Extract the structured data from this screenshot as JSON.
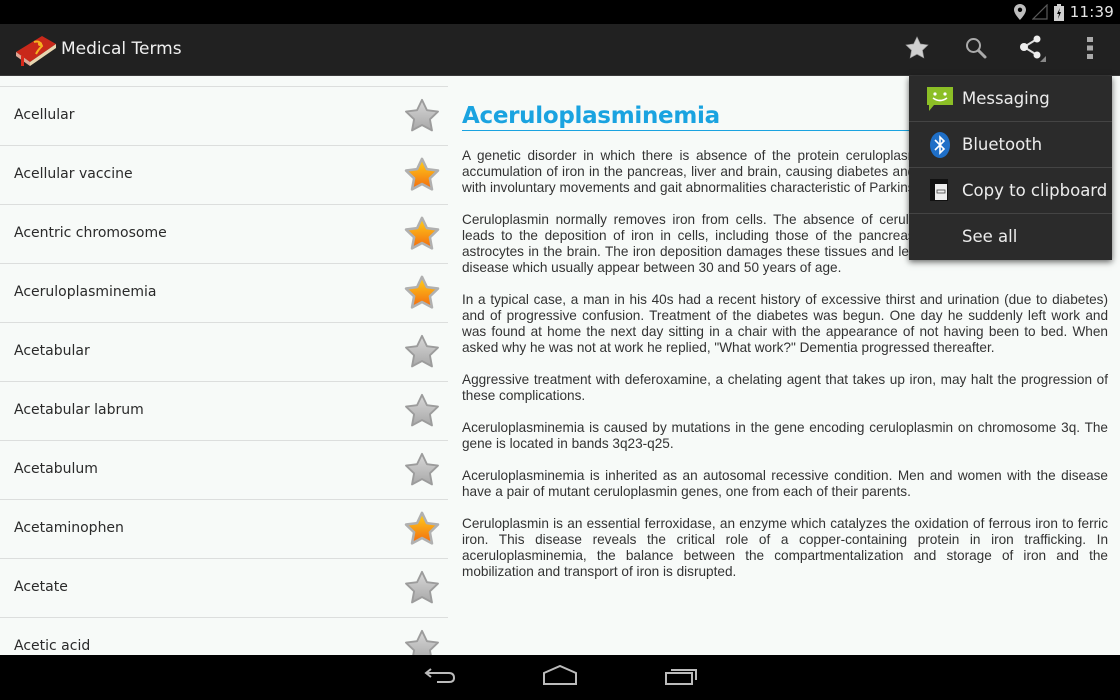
{
  "status_bar": {
    "time": "11:39",
    "icons": [
      "location-icon",
      "signal-icon",
      "battery-charging-icon"
    ]
  },
  "action_bar": {
    "title": "Medical Terms",
    "logo_icon": "medical-book-icon",
    "actions": [
      {
        "name": "favorites",
        "icon": "star-icon"
      },
      {
        "name": "search",
        "icon": "search-icon"
      },
      {
        "name": "share",
        "icon": "share-icon"
      },
      {
        "name": "overflow",
        "icon": "overflow-menu-icon"
      }
    ]
  },
  "term_list": {
    "items": [
      {
        "label": "Acellular",
        "favorite": false
      },
      {
        "label": "Acellular vaccine",
        "favorite": true
      },
      {
        "label": "Acentric chromosome",
        "favorite": true
      },
      {
        "label": "Aceruloplasminemia",
        "favorite": true
      },
      {
        "label": "Acetabular",
        "favorite": false
      },
      {
        "label": "Acetabular labrum",
        "favorite": false
      },
      {
        "label": "Acetabulum",
        "favorite": false
      },
      {
        "label": "Acetaminophen",
        "favorite": true
      },
      {
        "label": "Acetate",
        "favorite": false
      },
      {
        "label": "Acetic acid",
        "favorite": false
      }
    ]
  },
  "detail": {
    "title": "Aceruloplasminemia",
    "paragraphs": [
      "A genetic disorder in which there is absence of the protein ceruloplasmin from the blood, causing an accumulation of iron in the pancreas, liver and brain, causing diabetes and progressive neurologic disease with involuntary movements and gait abnormalities characteristic of Parkinson disease.",
      "Ceruloplasmin normally removes iron from cells. The absence of ceruloplasmin in aceruloplasminemia leads to the deposition of iron in cells, including those of the pancreas, liver, retina and neurons and astrocytes in the brain. The iron deposition damages these tissues and leads to the clinical features of the disease which usually appear between 30 and 50 years of age.",
      "In a typical case, a man in his 40s had a recent history of excessive thirst and urination (due to diabetes) and of progressive confusion. Treatment of the diabetes was begun. One day he suddenly left work and was found at home the next day sitting in a chair with the appearance of not having been to bed. When asked why he was not at work he replied, \"What work?\" Dementia progressed thereafter.",
      "Aggressive treatment with deferoxamine, a chelating agent that takes up iron, may halt the progression of these complications.",
      "Aceruloplasminemia is caused by mutations in the gene encoding ceruloplasmin on chromosome 3q. The gene is located in bands 3q23-q25.",
      "Aceruloplasminemia is inherited as an autosomal recessive condition. Men and women with the disease have a pair of mutant ceruloplasmin genes, one from each of their parents.",
      "Ceruloplasmin is an essential ferroxidase, an enzyme which catalyzes the oxidation of ferrous iron to ferric iron. This disease reveals the critical role of a copper-containing protein in iron trafficking. In aceruloplasminemia, the balance between the compartmentalization and storage of iron and the mobilization and transport of iron is disrupted."
    ]
  },
  "share_menu": {
    "items": [
      {
        "label": "Messaging",
        "icon": "messaging-icon"
      },
      {
        "label": "Bluetooth",
        "icon": "bluetooth-icon"
      },
      {
        "label": "Copy to clipboard",
        "icon": "clipboard-icon"
      },
      {
        "label": "See all",
        "icon": ""
      }
    ]
  },
  "nav_bar": {
    "buttons": [
      "back",
      "home",
      "recent-apps"
    ]
  },
  "colors": {
    "accent": "#1aa3e0",
    "action_bar_bg": "#212121",
    "content_bg": "#f7faf8",
    "menu_bg": "#2b2b2b",
    "favorite_star": "#f7a416"
  }
}
